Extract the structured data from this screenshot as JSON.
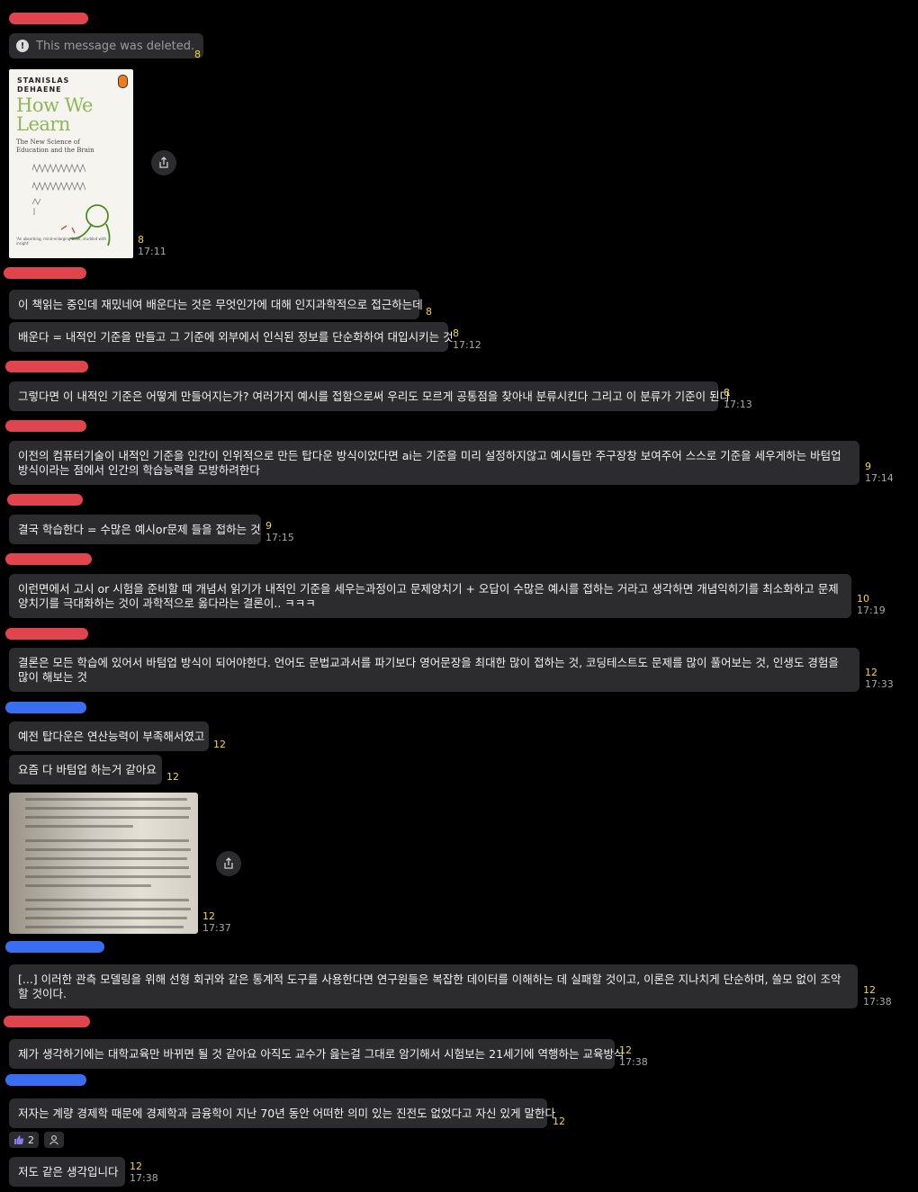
{
  "deleted_text": "This message was deleted.",
  "book": {
    "author": "STANISLAS DEHAENE",
    "title": "How We Learn",
    "subtitle": "The New Science of Education and the Brain",
    "quote": "'An absorbing, mind-enlarging book, studded with insight'"
  },
  "messages": {
    "m1": "이 책읽는 중인데 재밌네여 배운다는 것은 무엇인가에 대해 인지과학적으로 접근하는데",
    "m2": "배운다 = 내적인 기준을 만들고 그 기준에 외부에서 인식된 정보를 단순화하여 대입시키는 것",
    "m3": "그렇다면 이 내적인 기준은 어떻게 만들어지는가? 여러가지 예시를 접함으로써 우리도 모르게 공통점을 찾아내 분류시킨다 그리고 이 분류가 기준이 된다",
    "m4": "이전의 컴퓨터기술이 내적인 기준을 인간이 인위적으로 만든 탑다운 방식이었다면 ai는 기준을 미리 설정하지않고 예시들만 주구장창 보여주어 스스로 기준을 세우게하는 바텀업 방식이라는 점에서 인간의 학습능력을 모방하려한다",
    "m5": "결국 학습한다 = 수많은 예시or문제 들을 접하는 것",
    "m6": "이런면에서 고시 or 시험을 준비할 때 개념서 읽기가 내적인 기준을 세우는과정이고 문제양치기 + 오답이 수많은 예시를 접하는 거라고 생각하면 개념익히기를 최소화하고 문제양치기를 극대화하는 것이 과학적으로 옳다라는 결론이.. ㅋㅋㅋ",
    "m7": "결론은 모든 학습에 있어서 바텀업 방식이 되어야한다. 언어도 문법교과서를 파기보다 영어문장을 최대한 많이 접하는 것, 코딩테스트도 문제를 많이 풀어보는 것, 인생도 경험을 많이 해보는 것",
    "m8": "예전 탑다운은 연산능력이 부족해서였고",
    "m9": "요즘 다 바텀업 하는거 같아요",
    "m10": "[...] 이러한 관측 모델링을 위해 선형 회귀와 같은 통계적 도구를 사용한다면 연구원들은 복잡한 데이터를 이해하는 데 실패할 것이고, 이론은 지나치게 단순하며, 쓸모 없이 조악할 것이다.",
    "m11": "제가 생각하기에는 대학교육만 바뀌면 될 것 같아요 아직도 교수가 읊는걸 그대로 암기해서 시험보는 21세기에 역행하는 교육방식",
    "m12": "저자는 계량 경제학 때문에 경제학과 금융학이 지난 70년 동안 어떠한 의미 있는 진전도 없었다고 자신 있게 말한다",
    "m13": "저도 같은 생각입니다"
  },
  "meta": {
    "deleted": {
      "read": "8"
    },
    "book": {
      "read": "8",
      "time": "17:11"
    },
    "m1": {
      "read": "8"
    },
    "m2": {
      "read": "8",
      "time": "17:12"
    },
    "m3": {
      "read": "8",
      "time": "17:13"
    },
    "m4": {
      "read": "9",
      "time": "17:14"
    },
    "m5": {
      "read": "9",
      "time": "17:15"
    },
    "m6": {
      "read": "10",
      "time": "17:19"
    },
    "m7": {
      "read": "12",
      "time": "17:33"
    },
    "m8": {
      "read": "12"
    },
    "m9": {
      "read": "12"
    },
    "photo": {
      "read": "12",
      "time": "17:37"
    },
    "m10": {
      "read": "12",
      "time": "17:38"
    },
    "m11": {
      "read": "12",
      "time": "17:38"
    },
    "m12": {
      "read": "12"
    },
    "m13": {
      "read": "12",
      "time": "17:38"
    }
  },
  "reactions": {
    "thumbs_count": "2",
    "icons": [
      "thumbs-up-icon",
      "person-icon"
    ]
  },
  "colors": {
    "background": "#000000",
    "bubble": "#2c2c2e",
    "read_count": "#f5d63a",
    "time": "#a8a8a8",
    "sender_red": "#e0444c",
    "sender_blue": "#3a6ef0"
  }
}
